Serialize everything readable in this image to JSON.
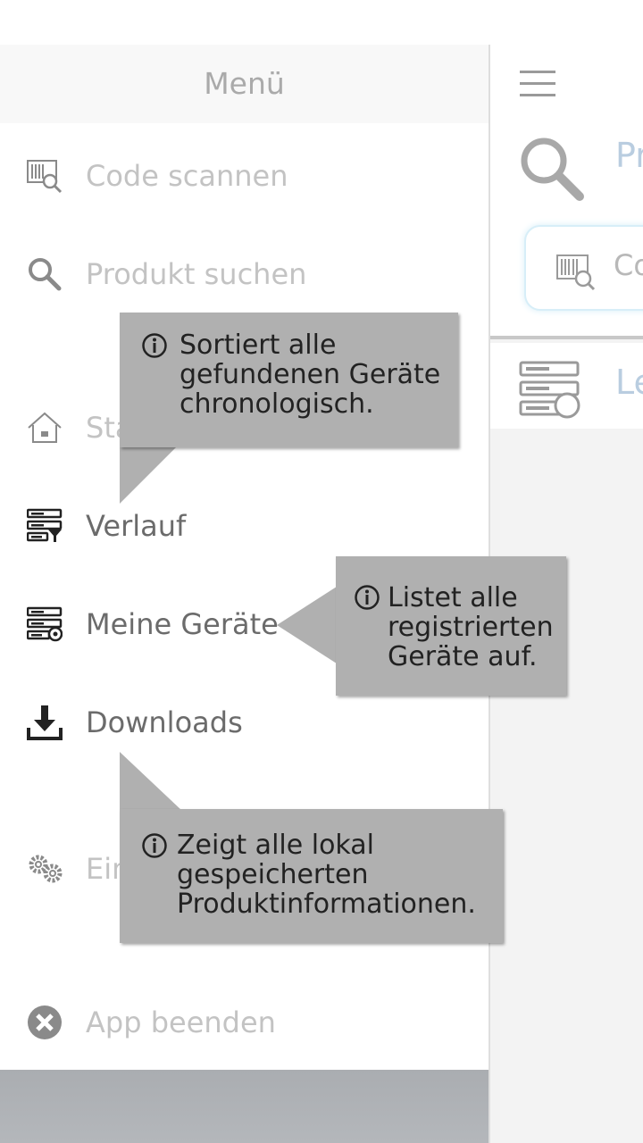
{
  "drawer": {
    "title": "Menü",
    "items": [
      {
        "label": "Code scannen",
        "icon": "barcode-scan-icon",
        "state": "disabled"
      },
      {
        "label": "Produkt suchen",
        "icon": "search-icon",
        "state": "disabled"
      },
      {
        "label": "Sta",
        "icon": "home-icon",
        "state": "disabled"
      },
      {
        "label": "Verlauf",
        "icon": "history-filter-icon",
        "state": "enabled"
      },
      {
        "label": "Meine Geräte",
        "icon": "my-devices-icon",
        "state": "enabled"
      },
      {
        "label": "Downloads",
        "icon": "download-icon",
        "state": "enabled"
      },
      {
        "label": "Ein",
        "icon": "gear-icon",
        "state": "disabled"
      },
      {
        "label": "App beenden",
        "icon": "close-circle-icon",
        "state": "disabled"
      }
    ]
  },
  "content": {
    "search_title": "Pr",
    "code_input_placeholder": "Co",
    "row2_title": "Le"
  },
  "tooltips": {
    "history": "Sortiert alle\ngefundenen Geräte\nchronologisch.",
    "my_devices": "Listet alle\nregistrierten\nGeräte auf.",
    "downloads": "Zeigt alle lokal\ngespeicherten\nProduktinformationen."
  },
  "colors": {
    "tooltip_bg": "#b0b0b0",
    "disabled_text": "#c3c3c3",
    "enabled_text": "#6b6b6b",
    "accent_light_blue": "#b9cde0"
  }
}
